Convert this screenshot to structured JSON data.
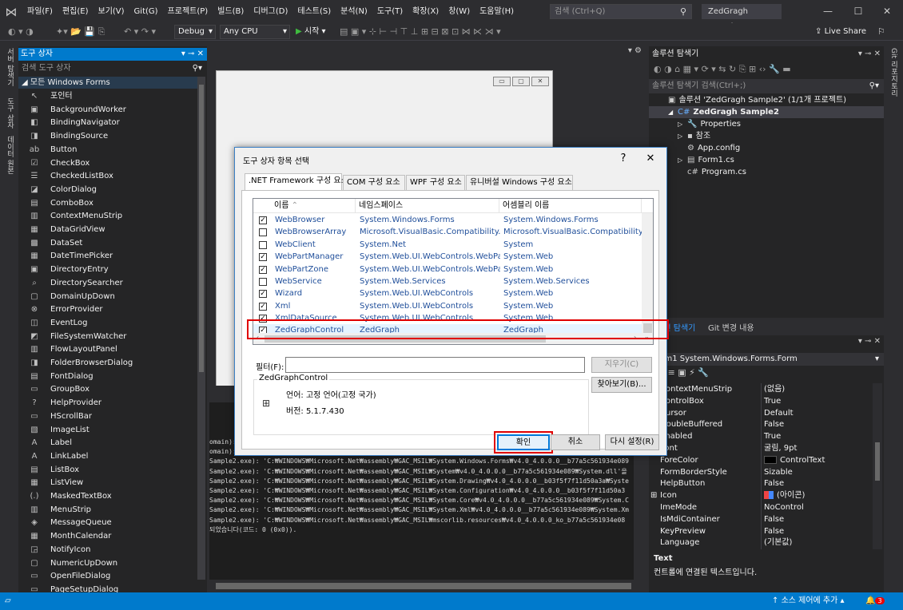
{
  "menu": [
    "파일(F)",
    "편집(E)",
    "보기(V)",
    "Git(G)",
    "프로젝트(P)",
    "빌드(B)",
    "디버그(D)",
    "테스트(S)",
    "분석(N)",
    "도구(T)",
    "확장(X)",
    "창(W)",
    "도움말(H)"
  ],
  "search_placeholder": "검색 (Ctrl+Q)",
  "solution_title": "ZedGragh Sample2",
  "toolbar": {
    "config": "Debug",
    "platform": "Any CPU",
    "start": "시작",
    "live_share": "Live Share"
  },
  "left_tabs": [
    "서버 탐색기",
    "도구 상자",
    "데이터 원본"
  ],
  "toolbox": {
    "title": "도구 상자",
    "search": "검색 도구 상자",
    "group": "모든 Windows Forms",
    "items": [
      "포인터",
      "BackgroundWorker",
      "BindingNavigator",
      "BindingSource",
      "Button",
      "CheckBox",
      "CheckedListBox",
      "ColorDialog",
      "ComboBox",
      "ContextMenuStrip",
      "DataGridView",
      "DataSet",
      "DateTimePicker",
      "DirectoryEntry",
      "DirectorySearcher",
      "DomainUpDown",
      "ErrorProvider",
      "EventLog",
      "FileSystemWatcher",
      "FlowLayoutPanel",
      "FolderBrowserDialog",
      "FontDialog",
      "GroupBox",
      "HelpProvider",
      "HScrollBar",
      "ImageList",
      "Label",
      "LinkLabel",
      "ListBox",
      "ListView",
      "MaskedTextBox",
      "MenuStrip",
      "MessageQueue",
      "MonthCalendar",
      "NotifyIcon",
      "NumericUpDown",
      "OpenFileDialog",
      "PageSetupDialog"
    ]
  },
  "output_lines": [
    "omain): ",
    "omain): ",
    " Sample2.exe): 'C:₩WINDOWS₩Microsoft.Net₩assembly₩GAC_MSIL₩System.Windows.Forms₩v4.0_4.0.0.0__b77a5c561934e089",
    " Sample2.exe): 'C:₩WINDOWS₩Microsoft.Net₩assembly₩GAC_MSIL₩System₩v4.0_4.0.0.0__b77a5c561934e089₩System.dll'을",
    " Sample2.exe): 'C:₩WINDOWS₩Microsoft.Net₩assembly₩GAC_MSIL₩System.Drawing₩v4.0_4.0.0.0__b03f5f7f11d50a3a₩Syste",
    " Sample2.exe): 'C:₩WINDOWS₩Microsoft.Net₩assembly₩GAC_MSIL₩System.Configuration₩v4.0_4.0.0.0__b03f5f7f11d50a3",
    " Sample2.exe): 'C:₩WINDOWS₩Microsoft.Net₩assembly₩GAC_MSIL₩System.Core₩v4.0_4.0.0.0__b77a5c561934e089₩System.C",
    " Sample2.exe): 'C:₩WINDOWS₩Microsoft.Net₩assembly₩GAC_MSIL₩System.Xml₩v4.0_4.0.0.0__b77a5c561934e089₩System.Xm",
    " Sample2.exe): 'C:₩WINDOWS₩Microsoft.Net₩assembly₩GAC_MSIL₩mscorlib.resources₩v4.0_4.0.0.0_ko_b77a5c561934e08",
    "되었습니다(코드: 0 (0x0))."
  ],
  "solexp": {
    "title": "솔루션 탐색기",
    "search": "솔루션 탐색기 검색(Ctrl+;)",
    "rows": [
      {
        "text": "솔루션 'ZedGragh Sample2' (1/1개 프로젝트)",
        "indent": 0,
        "icon": "▣"
      },
      {
        "text": "ZedGragh Sample2",
        "indent": 1,
        "icon": "C#",
        "bold": true,
        "arrow": "◢"
      },
      {
        "text": "Properties",
        "indent": 2,
        "icon": "🔧",
        "arrow": "▷"
      },
      {
        "text": "참조",
        "indent": 2,
        "icon": "▪",
        "arrow": "▷"
      },
      {
        "text": "App.config",
        "indent": 2,
        "icon": "⚙"
      },
      {
        "text": "Form1.cs",
        "indent": 2,
        "icon": "▤",
        "arrow": "▷"
      },
      {
        "text": "Program.cs",
        "indent": 2,
        "icon": "c#"
      }
    ],
    "tabs": [
      "솔루션 탐색기",
      "Git 변경 내용"
    ]
  },
  "properties": {
    "object": "Form1  System.Windows.Forms.Form",
    "rows": [
      {
        "name": "ContextMenuStrip",
        "value": "(없음)"
      },
      {
        "name": "ControlBox",
        "value": "True"
      },
      {
        "name": "Cursor",
        "value": "Default"
      },
      {
        "name": "DoubleBuffered",
        "value": "False"
      },
      {
        "name": "Enabled",
        "value": "True"
      },
      {
        "name": "Font",
        "value": "굴림, 9pt"
      },
      {
        "name": "ForeColor",
        "value": "ControlText"
      },
      {
        "name": "FormBorderStyle",
        "value": "Sizable"
      },
      {
        "name": "HelpButton",
        "value": "False"
      },
      {
        "name": "Icon",
        "value": "(아이콘)"
      },
      {
        "name": "ImeMode",
        "value": "NoControl"
      },
      {
        "name": "IsMdiContainer",
        "value": "False"
      },
      {
        "name": "KeyPreview",
        "value": "False"
      },
      {
        "name": "Language",
        "value": "(기본값)"
      }
    ],
    "desc_title": "Text",
    "desc_text": "컨트롤에 연결된 텍스트입니다."
  },
  "status": {
    "source_control": "소스 제어에 추가",
    "badge": "3"
  },
  "dialog": {
    "title": "도구 상자 항목 선택",
    "help": "?",
    "close": "✕",
    "tabs": [
      ".NET Framework 구성 요소",
      "COM 구성 요소",
      "WPF 구성 요소",
      "유니버설 Windows 구성 요소"
    ],
    "columns": [
      "이름",
      "네임스페이스",
      "어셈블리 이름"
    ],
    "rows": [
      {
        "checked": true,
        "name": "WebBrowser",
        "ns": "System.Windows.Forms",
        "asm": "System.Windows.Forms"
      },
      {
        "checked": false,
        "name": "WebBrowserArray",
        "ns": "Microsoft.VisualBasic.Compatibility.VB6",
        "asm": "Microsoft.VisualBasic.Compatibility"
      },
      {
        "checked": false,
        "name": "WebClient",
        "ns": "System.Net",
        "asm": "System"
      },
      {
        "checked": true,
        "name": "WebPartManager",
        "ns": "System.Web.UI.WebControls.WebParts",
        "asm": "System.Web"
      },
      {
        "checked": true,
        "name": "WebPartZone",
        "ns": "System.Web.UI.WebControls.WebParts",
        "asm": "System.Web"
      },
      {
        "checked": false,
        "name": "WebService",
        "ns": "System.Web.Services",
        "asm": "System.Web.Services"
      },
      {
        "checked": true,
        "name": "Wizard",
        "ns": "System.Web.UI.WebControls",
        "asm": "System.Web"
      },
      {
        "checked": true,
        "name": "Xml",
        "ns": "System.Web.UI.WebControls",
        "asm": "System.Web"
      },
      {
        "checked": true,
        "name": "XmlDataSource",
        "ns": "System.Web.UI.WebControls",
        "asm": "System.Web"
      },
      {
        "checked": true,
        "name": "ZedGraphControl",
        "ns": "ZedGraph",
        "asm": "ZedGraph"
      }
    ],
    "filter_label": "필터(F):",
    "clear_button": "지우기(C)",
    "browse_button": "찾아보기(B)...",
    "info_group": "ZedGraphControl",
    "info_language": "언어: 고정 언어(고정 국가)",
    "info_version": "버전: 5.1.7.430",
    "ok_button": "확인",
    "cancel_button": "취소",
    "reset_button": "다시 설정(R)"
  },
  "colors": {
    "accent": "#007acc",
    "highlight": "#e00000"
  }
}
